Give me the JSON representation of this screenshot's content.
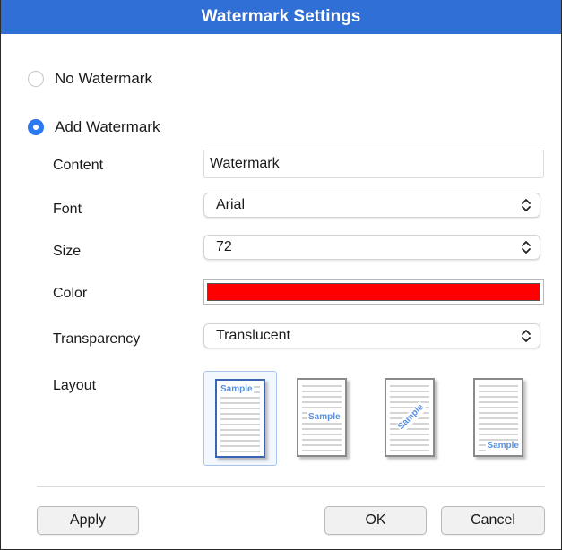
{
  "dialog": {
    "title": "Watermark Settings"
  },
  "options": {
    "no_watermark": {
      "label": "No Watermark",
      "checked": false
    },
    "add_watermark": {
      "label": "Add Watermark",
      "checked": true
    }
  },
  "fields": {
    "content": {
      "label": "Content",
      "value": "Watermark"
    },
    "font": {
      "label": "Font",
      "value": "Arial"
    },
    "size": {
      "label": "Size",
      "value": "72"
    },
    "color": {
      "label": "Color",
      "value": "#ff0000"
    },
    "transparency": {
      "label": "Transparency",
      "value": "Translucent"
    },
    "layout": {
      "label": "Layout",
      "options": [
        {
          "text": "Sample",
          "position": "top-left",
          "selected": true
        },
        {
          "text": "Sample",
          "position": "center",
          "selected": false
        },
        {
          "text": "Sample",
          "position": "diagonal",
          "selected": false
        },
        {
          "text": "Sample",
          "position": "bottom-right",
          "selected": false
        }
      ]
    }
  },
  "buttons": {
    "apply": "Apply",
    "ok": "OK",
    "cancel": "Cancel"
  },
  "colors": {
    "title_bar": "#2f6fd6",
    "accent": "#2a79f2",
    "watermark_text": "#5a8fe0"
  },
  "icons": {
    "select_arrows": "chevron-updown-icon"
  }
}
